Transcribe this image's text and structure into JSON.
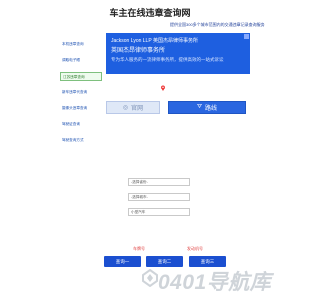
{
  "header": {
    "site_title": "车主在线违章查询网",
    "tagline": "提供全国300多个城市范围内的交通违章记录查询服务"
  },
  "sidebar": {
    "items": [
      {
        "label": "本机违章查询"
      },
      {
        "label": "调取电子眼"
      },
      {
        "label": "江苏违章查询"
      },
      {
        "label": "新车违章代查询"
      },
      {
        "label": "摄像头违章查询"
      },
      {
        "label": "驾驶证查询"
      },
      {
        "label": "驾驶查询方式"
      }
    ],
    "active_index": 2
  },
  "ad": {
    "line1": "Jackson Lyon LLP 英国杰昂律师事务所",
    "line2": "英国杰昂律师事务所",
    "line3": "专为华人服务的一流律师事务所，提供高效的一站式诉讼",
    "bg_color": "#1e5fe0"
  },
  "actions": {
    "site_label": "官网",
    "site_icon": "globe-icon",
    "route_label": "路线",
    "route_icon": "route-icon"
  },
  "form": {
    "province_select": "-选择省份-",
    "city_select": "-选择城市-",
    "type_select": "小型汽车"
  },
  "tips": {
    "left": "车牌号",
    "right": "发动机号"
  },
  "buttons": {
    "query1": "查询一",
    "query2": "查询二",
    "query3": "查询三"
  },
  "watermark": {
    "text": "0401导航库",
    "logo_icon": "navigation-logo-icon"
  },
  "colors": {
    "accent": "#2a66e0",
    "link": "#1a4fb0",
    "tip": "#e04040"
  }
}
